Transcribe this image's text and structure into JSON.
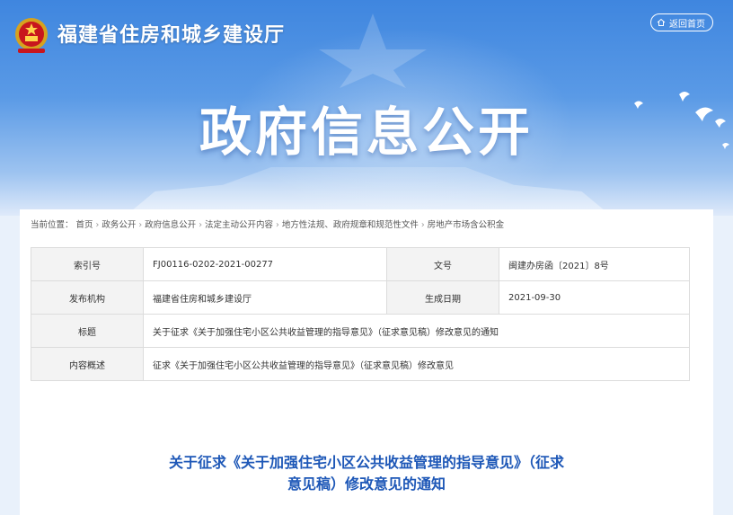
{
  "header": {
    "site_name": "福建省住房和城乡建设厅",
    "home_label": "返回首页",
    "banner_title": "政府信息公开"
  },
  "breadcrumb": {
    "prefix": "当前位置：",
    "items": [
      "首页",
      "政务公开",
      "政府信息公开",
      "法定主动公开内容",
      "地方性法规、政府规章和规范性文件",
      "房地产市场含公积金"
    ],
    "separator": "›"
  },
  "meta": {
    "index_label": "索引号",
    "index_value": "FJ00116-0202-2021-00277",
    "docno_label": "文号",
    "docno_value": "闽建办房函〔2021〕8号",
    "issuer_label": "发布机构",
    "issuer_value": "福建省住房和城乡建设厅",
    "date_label": "生成日期",
    "date_value": "2021-09-30",
    "title_label": "标题",
    "title_value": "关于征求《关于加强住宅小区公共收益管理的指导意见》（征求意见稿）修改意见的通知",
    "summary_label": "内容概述",
    "summary_value": "征求《关于加强住宅小区公共收益管理的指导意见》（征求意见稿）修改意见"
  },
  "article": {
    "title_line1": "关于征求《关于加强住宅小区公共收益管理的指导意见》（征求",
    "title_line2": "意见稿）修改意见的通知"
  },
  "colors": {
    "title_blue": "#1d57b7",
    "banner_blue": "#3f86df"
  }
}
